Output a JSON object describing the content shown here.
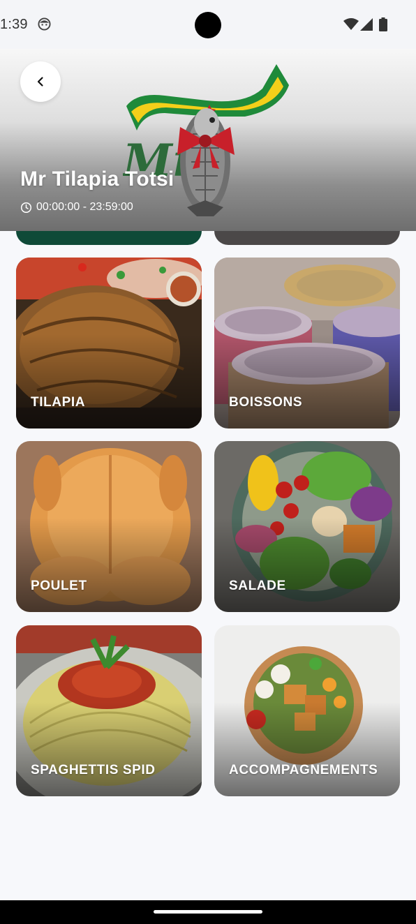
{
  "status_bar": {
    "time": "1:39",
    "icons": [
      "face-icon",
      "wifi-icon",
      "signal-icon",
      "battery-icon"
    ]
  },
  "header": {
    "title": "Mr Tilapia Totsi",
    "hours": "00:00:00 - 23:59:00",
    "back_icon": "chevron-left-icon",
    "clock_icon": "clock-icon",
    "logo_text": "Mr"
  },
  "categories": [
    {
      "label": "TILAPIA"
    },
    {
      "label": "BOISSONS"
    },
    {
      "label": "POULET"
    },
    {
      "label": "SALADE"
    },
    {
      "label": "SPAGHETTIS SPID"
    },
    {
      "label": "ACCOMPAGNEMENTS"
    }
  ],
  "colors": {
    "background": "#f7f8fb",
    "card_text": "#ffffff",
    "peek_left": "#0f4a38",
    "peek_right": "#4a4747"
  }
}
